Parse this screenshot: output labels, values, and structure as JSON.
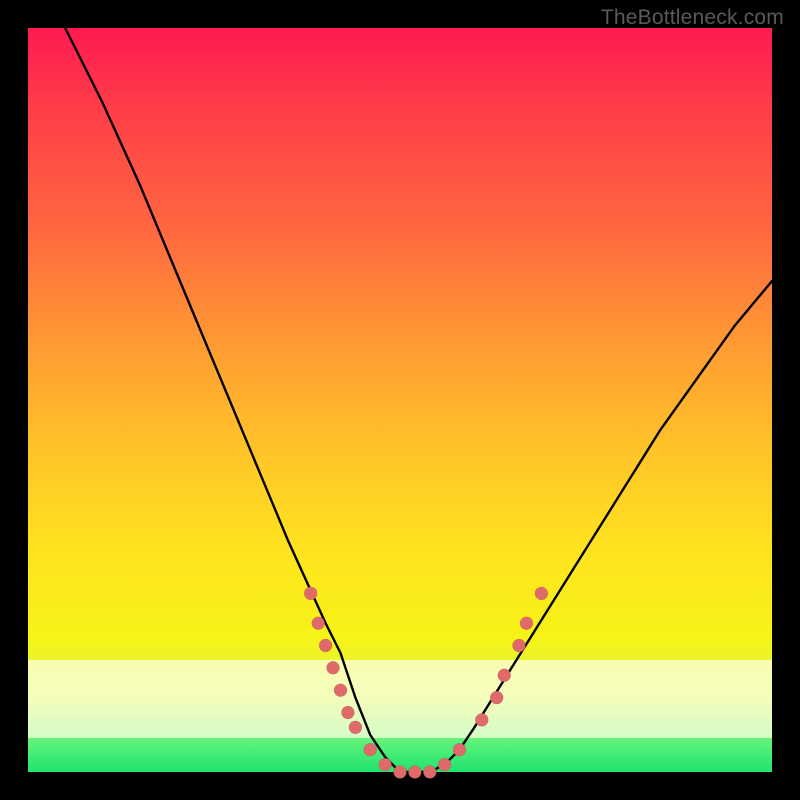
{
  "watermark": "TheBottleneck.com",
  "colors": {
    "gradient_top": "#ff1a52",
    "gradient_bottom": "#20e36e",
    "curve": "#000000",
    "dots": "#e06a6a",
    "frame_bg": "#000000"
  },
  "chart_data": {
    "type": "line",
    "title": "",
    "xlabel": "",
    "ylabel": "",
    "xlim": [
      0,
      100
    ],
    "ylim": [
      0,
      100
    ],
    "grid": false,
    "legend": false,
    "series": [
      {
        "name": "bottleneck-curve",
        "x": [
          5,
          10,
          15,
          20,
          25,
          30,
          35,
          40,
          42,
          44,
          46,
          48,
          50,
          52,
          54,
          56,
          58,
          60,
          65,
          70,
          75,
          80,
          85,
          90,
          95,
          100
        ],
        "y": [
          100,
          90,
          79,
          67,
          55,
          43,
          31,
          20,
          16,
          10,
          5,
          2,
          0,
          0,
          0,
          1,
          3,
          6,
          14,
          22,
          30,
          38,
          46,
          53,
          60,
          66
        ]
      }
    ],
    "dots": [
      {
        "x": 38,
        "y": 24
      },
      {
        "x": 39,
        "y": 20
      },
      {
        "x": 40,
        "y": 17
      },
      {
        "x": 41,
        "y": 14
      },
      {
        "x": 42,
        "y": 11
      },
      {
        "x": 43,
        "y": 8
      },
      {
        "x": 44,
        "y": 6
      },
      {
        "x": 46,
        "y": 3
      },
      {
        "x": 48,
        "y": 1
      },
      {
        "x": 50,
        "y": 0
      },
      {
        "x": 52,
        "y": 0
      },
      {
        "x": 54,
        "y": 0
      },
      {
        "x": 56,
        "y": 1
      },
      {
        "x": 58,
        "y": 3
      },
      {
        "x": 61,
        "y": 7
      },
      {
        "x": 63,
        "y": 10
      },
      {
        "x": 64,
        "y": 13
      },
      {
        "x": 66,
        "y": 17
      },
      {
        "x": 67,
        "y": 20
      },
      {
        "x": 69,
        "y": 24
      }
    ],
    "notes": "V-shaped bottleneck curve over a red→green vertical gradient; pink dots cluster along the lower arms of the V near its minimum. No axis ticks or numeric labels are shown."
  }
}
